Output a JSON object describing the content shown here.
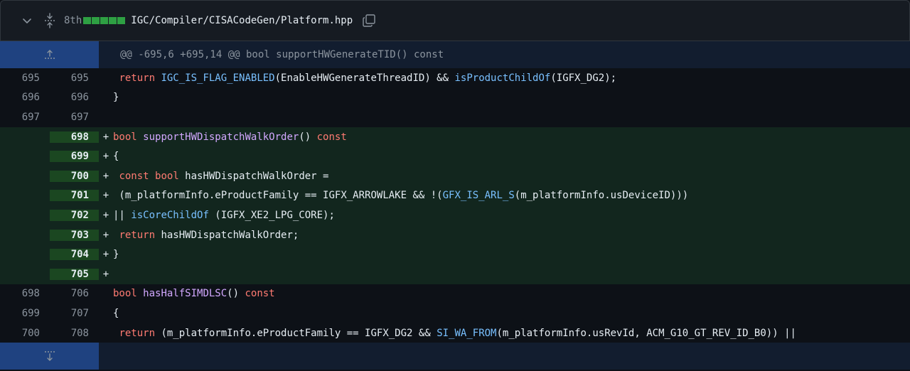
{
  "file": {
    "change_count": "8th",
    "path": "IGC/Compiler/CISACodeGen/Platform.hpp"
  },
  "hunk": {
    "header": "@@ -695,6 +695,14 @@ bool supportHWGenerateTID() const"
  },
  "lines": [
    {
      "type": "context",
      "old": "695",
      "new": "695",
      "sign": "",
      "tokens": [
        [
          " ",
          "pl"
        ],
        [
          "return",
          "kw"
        ],
        [
          " ",
          "pl"
        ],
        [
          "IGC_IS_FLAG_ENABLED",
          "mac"
        ],
        [
          "(EnableHWGenerateThreadID) && ",
          "pl"
        ],
        [
          "isProductChildOf",
          "mac"
        ],
        [
          "(IGFX_DG2);",
          "pl"
        ]
      ]
    },
    {
      "type": "context",
      "old": "696",
      "new": "696",
      "sign": "",
      "tokens": [
        [
          "}",
          "pl"
        ]
      ]
    },
    {
      "type": "context",
      "old": "697",
      "new": "697",
      "sign": "",
      "tokens": []
    },
    {
      "type": "add",
      "old": "",
      "new": "698",
      "sign": "+",
      "tokens": [
        [
          "bool",
          "kw"
        ],
        [
          " ",
          "pl"
        ],
        [
          "supportHWDispatchWalkOrder",
          "fn"
        ],
        [
          "() ",
          "pl"
        ],
        [
          "const",
          "kw"
        ]
      ]
    },
    {
      "type": "add",
      "old": "",
      "new": "699",
      "sign": "+",
      "tokens": [
        [
          "{",
          "pl"
        ]
      ]
    },
    {
      "type": "add",
      "old": "",
      "new": "700",
      "sign": "+",
      "tokens": [
        [
          " ",
          "pl"
        ],
        [
          "const",
          "kw"
        ],
        [
          " ",
          "pl"
        ],
        [
          "bool",
          "kw"
        ],
        [
          " hasHWDispatchWalkOrder =",
          "pl"
        ]
      ]
    },
    {
      "type": "add",
      "old": "",
      "new": "701",
      "sign": "+",
      "tokens": [
        [
          " (m_platformInfo.",
          "pl"
        ],
        [
          "eProductFamily",
          "prop"
        ],
        [
          " == IGFX_ARROWLAKE && !(",
          "pl"
        ],
        [
          "GFX_IS_ARL_S",
          "mac"
        ],
        [
          "(m_platformInfo.",
          "pl"
        ],
        [
          "usDeviceID",
          "prop"
        ],
        [
          ")))",
          "pl"
        ]
      ]
    },
    {
      "type": "add",
      "old": "",
      "new": "702",
      "sign": "+",
      "tokens": [
        [
          "|| ",
          "pl"
        ],
        [
          "isCoreChildOf",
          "mac"
        ],
        [
          " (IGFX_XE2_LPG_CORE);",
          "pl"
        ]
      ]
    },
    {
      "type": "add",
      "old": "",
      "new": "703",
      "sign": "+",
      "tokens": [
        [
          " ",
          "pl"
        ],
        [
          "return",
          "kw"
        ],
        [
          " hasHWDispatchWalkOrder;",
          "pl"
        ]
      ]
    },
    {
      "type": "add",
      "old": "",
      "new": "704",
      "sign": "+",
      "tokens": [
        [
          "}",
          "pl"
        ]
      ]
    },
    {
      "type": "add",
      "old": "",
      "new": "705",
      "sign": "+",
      "tokens": []
    },
    {
      "type": "context",
      "old": "698",
      "new": "706",
      "sign": "",
      "tokens": [
        [
          "bool",
          "kw"
        ],
        [
          " ",
          "pl"
        ],
        [
          "hasHalfSIMDLSC",
          "fn"
        ],
        [
          "() ",
          "pl"
        ],
        [
          "const",
          "kw"
        ]
      ]
    },
    {
      "type": "context",
      "old": "699",
      "new": "707",
      "sign": "",
      "tokens": [
        [
          "{",
          "pl"
        ]
      ]
    },
    {
      "type": "context",
      "old": "700",
      "new": "708",
      "sign": "",
      "tokens": [
        [
          " ",
          "pl"
        ],
        [
          "return",
          "kw"
        ],
        [
          " (m_platformInfo.",
          "pl"
        ],
        [
          "eProductFamily",
          "prop"
        ],
        [
          " == IGFX_DG2 && ",
          "pl"
        ],
        [
          "SI_WA_FROM",
          "mac"
        ],
        [
          "(m_platformInfo.",
          "pl"
        ],
        [
          "usRevId",
          "prop"
        ],
        [
          ", ACM_G10_GT_REV_ID_B0)) ||",
          "pl"
        ]
      ]
    }
  ],
  "colors": {
    "background": "#0d1117",
    "add_line": "#12261e",
    "add_gutter": "#1b4721",
    "hunk_bg": "#121d2f",
    "expand_gutter": "#1f4280",
    "keyword": "#ff7b72",
    "function": "#d2a8ff",
    "macro": "#79c0ff",
    "diffstat_green": "#2ea043"
  },
  "icons": {
    "collapse": "chevron-down-icon",
    "expand_all": "unfold-icon",
    "copy": "copy-icon",
    "expand_up": "expand-up-icon",
    "expand_down": "expand-down-icon"
  }
}
